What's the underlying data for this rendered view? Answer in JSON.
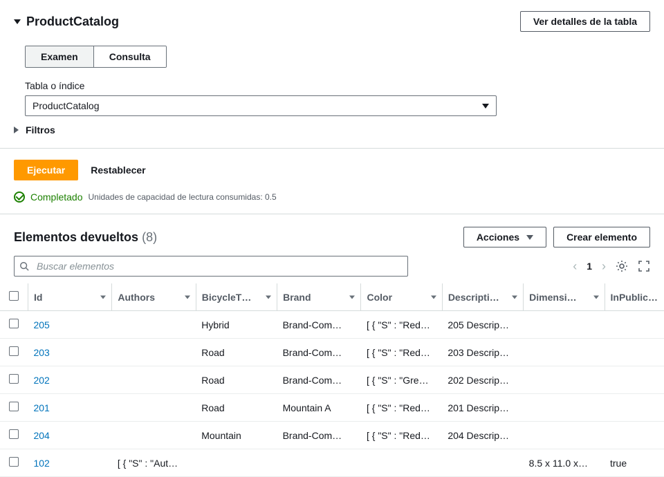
{
  "header": {
    "title": "ProductCatalog",
    "view_details_btn": "Ver detalles de la tabla"
  },
  "query": {
    "tab_examen": "Examen",
    "tab_consulta": "Consulta",
    "index_label": "Tabla o índice",
    "index_value": "ProductCatalog",
    "filters_label": "Filtros"
  },
  "actions": {
    "execute": "Ejecutar",
    "reset": "Restablecer",
    "completed": "Completado",
    "capacity_consumed": "Unidades de capacidad de lectura consumidas: 0.5"
  },
  "results": {
    "title": "Elementos devueltos",
    "count": "(8)",
    "actions_btn": "Acciones",
    "create_btn": "Crear elemento",
    "search_placeholder": "Buscar elementos",
    "page": "1"
  },
  "columns": {
    "id": "Id",
    "authors": "Authors",
    "btype": "BicycleT…",
    "brand": "Brand",
    "color": "Color",
    "desc": "Descripti…",
    "dim": "Dimensi…",
    "inpub": "InPublic…"
  },
  "rows": [
    {
      "id": "205",
      "authors": "",
      "btype": "Hybrid",
      "brand": "Brand-Com…",
      "color": "[ { \"S\" : \"Red…",
      "desc": "205 Descrip…",
      "dim": "",
      "inpub": ""
    },
    {
      "id": "203",
      "authors": "",
      "btype": "Road",
      "brand": "Brand-Com…",
      "color": "[ { \"S\" : \"Red…",
      "desc": "203 Descrip…",
      "dim": "",
      "inpub": ""
    },
    {
      "id": "202",
      "authors": "",
      "btype": "Road",
      "brand": "Brand-Com…",
      "color": "[ { \"S\" : \"Gre…",
      "desc": "202 Descrip…",
      "dim": "",
      "inpub": ""
    },
    {
      "id": "201",
      "authors": "",
      "btype": "Road",
      "brand": "Mountain A",
      "color": "[ { \"S\" : \"Red…",
      "desc": "201 Descrip…",
      "dim": "",
      "inpub": ""
    },
    {
      "id": "204",
      "authors": "",
      "btype": "Mountain",
      "brand": "Brand-Com…",
      "color": "[ { \"S\" : \"Red…",
      "desc": "204 Descrip…",
      "dim": "",
      "inpub": ""
    },
    {
      "id": "102",
      "authors": "[ { \"S\" : \"Aut…",
      "btype": "",
      "brand": "",
      "color": "",
      "desc": "",
      "dim": "8.5 x 11.0 x…",
      "inpub": "true"
    }
  ]
}
